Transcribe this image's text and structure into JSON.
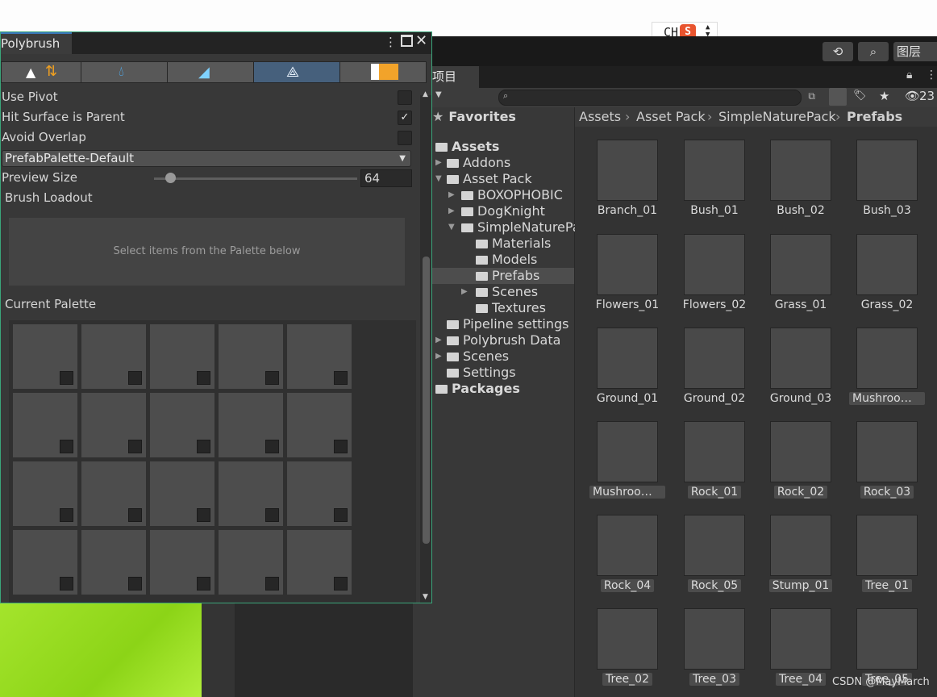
{
  "ime": {
    "lang": "CH",
    "logo": "S"
  },
  "toolbar": {
    "history_icon": "history-icon",
    "search_icon": "search-icon",
    "layers_label": "图层"
  },
  "project": {
    "tab_label": "项目",
    "hidden_count": "23",
    "favorites_label": "Favorites",
    "breadcrumb": [
      "Assets",
      "Asset Pack",
      "SimpleNaturePack",
      "Prefabs"
    ],
    "tree": [
      {
        "label": "Assets",
        "bold": true
      },
      {
        "label": "Addons"
      },
      {
        "label": "Asset Pack"
      },
      {
        "label": "BOXOPHOBIC"
      },
      {
        "label": "DogKnight"
      },
      {
        "label": "SimpleNaturePa"
      },
      {
        "label": "Materials"
      },
      {
        "label": "Models"
      },
      {
        "label": "Prefabs"
      },
      {
        "label": "Scenes"
      },
      {
        "label": "Textures"
      },
      {
        "label": "Pipeline settings"
      },
      {
        "label": "Polybrush Data"
      },
      {
        "label": "Scenes"
      },
      {
        "label": "Settings"
      },
      {
        "label": "Packages",
        "bold": true
      }
    ],
    "assets": [
      "Branch_01",
      "Bush_01",
      "Bush_02",
      "Bush_03",
      "Flowers_01",
      "Flowers_02",
      "Grass_01",
      "Grass_02",
      "Ground_01",
      "Ground_02",
      "Ground_03",
      "Mushroom…",
      "Mushroom…",
      "Rock_01",
      "Rock_02",
      "Rock_03",
      "Rock_04",
      "Rock_05",
      "Stump_01",
      "Tree_01",
      "Tree_02",
      "Tree_03",
      "Tree_04",
      "Tree_05"
    ]
  },
  "polybrush": {
    "title": "Polybrush",
    "use_pivot": "Use Pivot",
    "hit_surface": "Hit Surface is Parent",
    "hit_surface_checked": true,
    "avoid_overlap": "Avoid Overlap",
    "palette_dropdown": "PrefabPalette-Default",
    "preview_size_label": "Preview Size",
    "preview_size_value": "64",
    "preview_size_level": 0.08,
    "brush_loadout": "Brush Loadout",
    "loadout_hint": "Select items from the Palette below",
    "current_palette": "Current Palette"
  },
  "watermark": "CSDN @MayMarch"
}
